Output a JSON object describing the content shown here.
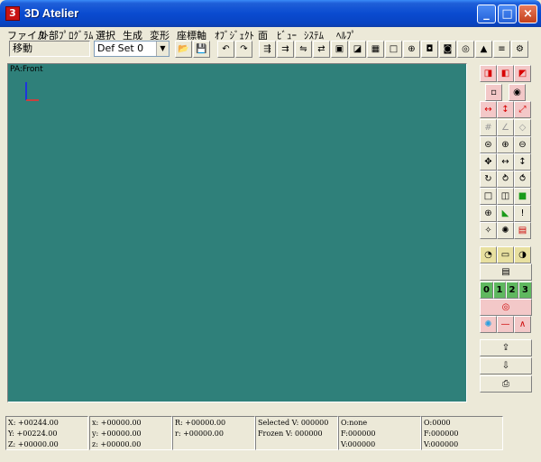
{
  "window": {
    "title": "3D Atelier",
    "min_label": "_",
    "max_label": "□",
    "close_label": "×"
  },
  "menu": [
    {
      "label": "ファイル"
    },
    {
      "label": "外部ﾌﾟﾛｸﾞﾗﾑ"
    },
    {
      "label": "選択"
    },
    {
      "label": "生成"
    },
    {
      "label": "変形"
    },
    {
      "label": "座標軸"
    },
    {
      "label": "ｵﾌﾞｼﾞｪｸﾄ"
    },
    {
      "label": "面"
    },
    {
      "label": "ﾋﾞｭｰ"
    },
    {
      "label": "ｼｽﾃﾑ"
    },
    {
      "label": "ﾍﾙﾌﾟ"
    }
  ],
  "toolbar": {
    "mode": "移動",
    "defset": "Def Set 0",
    "icons": [
      "open-icon",
      "save-icon",
      "undo-icon",
      "redo-icon",
      "transform-1-icon",
      "transform-2-icon",
      "transform-3-icon",
      "transform-4-icon",
      "cube-front-icon",
      "cube-green-icon",
      "grid-icon",
      "box-icon",
      "sphere-icon",
      "cylinder-icon",
      "cylinder-2-icon",
      "torus-icon",
      "cone-icon",
      "disk-stack-icon",
      "gear-icon",
      "view-icon"
    ]
  },
  "viewport": {
    "label": "PA:Front"
  },
  "statusbar": {
    "col1": [
      "X: +00244.00",
      "Y: +00224.00",
      "Z: +00000.00"
    ],
    "col2": [
      "x: +00000.00",
      "y: +00000.00",
      "z: +00000.00"
    ],
    "col3": [
      "R: +00000.00",
      "r: +00000.00"
    ],
    "col4": [
      "Selected V: 000000",
      "Frozen V: 000000"
    ],
    "col5": [
      "O:none",
      "F:000000",
      "V:000000"
    ],
    "col6": [
      "O:0000",
      "F:000000",
      "V:000000"
    ]
  },
  "colors": {
    "viewport": "#2f807a",
    "titlebar": "#0a4bd0",
    "background": "#ece9d8"
  }
}
